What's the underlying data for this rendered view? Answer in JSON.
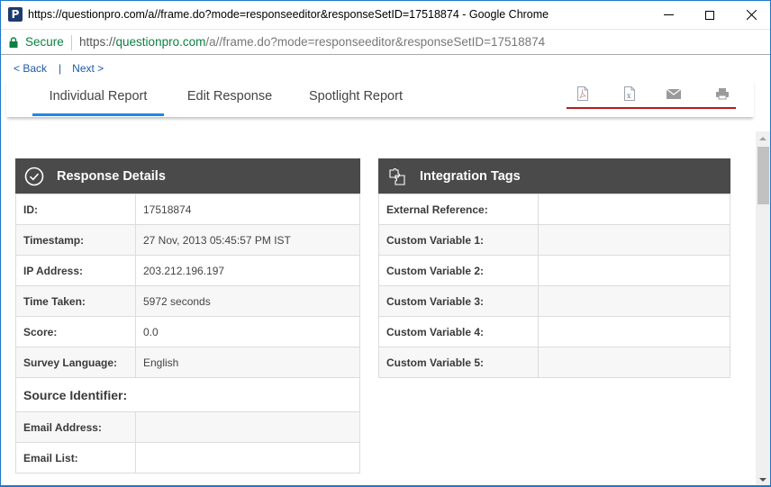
{
  "window": {
    "title": "https://questionpro.com/a//frame.do?mode=responseeditor&responseSetID=17518874 - Google Chrome",
    "app_icon": "questionpro-icon"
  },
  "addressbar": {
    "secure_label": "Secure",
    "url_scheme": "https://",
    "url_host": "questionpro.com",
    "url_path": "/a//frame.do?mode=responseeditor&responseSetID=17518874"
  },
  "nav": {
    "back_label": "< Back",
    "separator": "|",
    "next_label": "Next >"
  },
  "tabs": [
    {
      "label": "Individual Report",
      "active": true
    },
    {
      "label": "Edit Response",
      "active": false
    },
    {
      "label": "Spotlight Report",
      "active": false
    }
  ],
  "toolbar": {
    "icons": [
      "pdf-icon",
      "excel-icon",
      "email-icon",
      "print-icon"
    ],
    "accent_color": "#b01c1c"
  },
  "response_details": {
    "title": "Response Details",
    "icon": "check-circle-icon",
    "rows": [
      {
        "label": "ID:",
        "value": "17518874"
      },
      {
        "label": "Timestamp:",
        "value": "27 Nov, 2013 05:45:57 PM IST"
      },
      {
        "label": "IP Address:",
        "value": "203.212.196.197"
      },
      {
        "label": "Time Taken:",
        "value": "5972 seconds"
      },
      {
        "label": "Score:",
        "value": "0.0"
      },
      {
        "label": "Survey Language:",
        "value": "English"
      }
    ],
    "source_section_title": "Source Identifier:",
    "source_rows": [
      {
        "label": "Email Address:",
        "value": ""
      },
      {
        "label": "Email List:",
        "value": ""
      }
    ]
  },
  "integration_tags": {
    "title": "Integration Tags",
    "icon": "puzzle-icon",
    "rows": [
      {
        "label": "External Reference:",
        "value": ""
      },
      {
        "label": "Custom Variable 1:",
        "value": ""
      },
      {
        "label": "Custom Variable 2:",
        "value": ""
      },
      {
        "label": "Custom Variable 3:",
        "value": ""
      },
      {
        "label": "Custom Variable 4:",
        "value": ""
      },
      {
        "label": "Custom Variable 5:",
        "value": ""
      }
    ]
  },
  "colors": {
    "tab_active": "#1e88e5",
    "panel_header": "#4a4a4a",
    "link": "#1e5aa8",
    "secure": "#0b8043"
  }
}
